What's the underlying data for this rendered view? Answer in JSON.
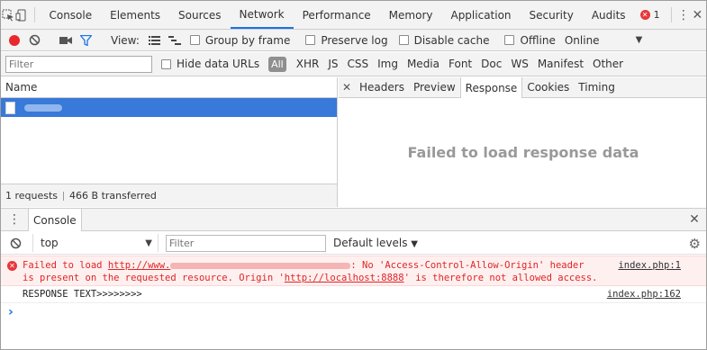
{
  "tabs": [
    "Console",
    "Elements",
    "Sources",
    "Network",
    "Performance",
    "Memory",
    "Application",
    "Security",
    "Audits"
  ],
  "active_tab": "Network",
  "error_count": "1",
  "toolbar": {
    "view_label": "View:",
    "group_by_frame": "Group by frame",
    "preserve_log": "Preserve log",
    "disable_cache": "Disable cache",
    "offline": "Offline",
    "throttling": "Online"
  },
  "filter_row": {
    "filter_placeholder": "Filter",
    "hide_data_urls": "Hide data URLs",
    "all": "All",
    "types": [
      "XHR",
      "JS",
      "CSS",
      "Img",
      "Media",
      "Font",
      "Doc",
      "WS",
      "Manifest",
      "Other"
    ]
  },
  "requests": {
    "column_name": "Name",
    "summary_requests": "1 requests",
    "summary_transferred": "466 B transferred"
  },
  "detail": {
    "tabs": [
      "Headers",
      "Preview",
      "Response",
      "Cookies",
      "Timing"
    ],
    "active_tab": "Response",
    "message": "Failed to load response data"
  },
  "drawer": {
    "tab": "Console",
    "context": "top",
    "filter_placeholder": "Filter",
    "levels": "Default levels"
  },
  "console": {
    "error_line1_prefix": "Failed to load",
    "error_url_start": "http://www.",
    "error_line1_suffix": ": No 'Access-Control-Allow-Origin' header",
    "error_line2_pre": "is present on the requested resource. Origin '",
    "error_origin": "http://localhost:8888",
    "error_line2_post": "' is therefore not allowed access.",
    "error_source": "index.php:1",
    "log_text": "RESPONSE TEXT>>>>>>>>",
    "log_source": "index.php:162"
  },
  "colors": {
    "accent": "#1a73e8",
    "selected_row": "#3879d9",
    "error_text": "#e02424",
    "error_bg": "#fff0f0",
    "record": "#e8282b"
  }
}
